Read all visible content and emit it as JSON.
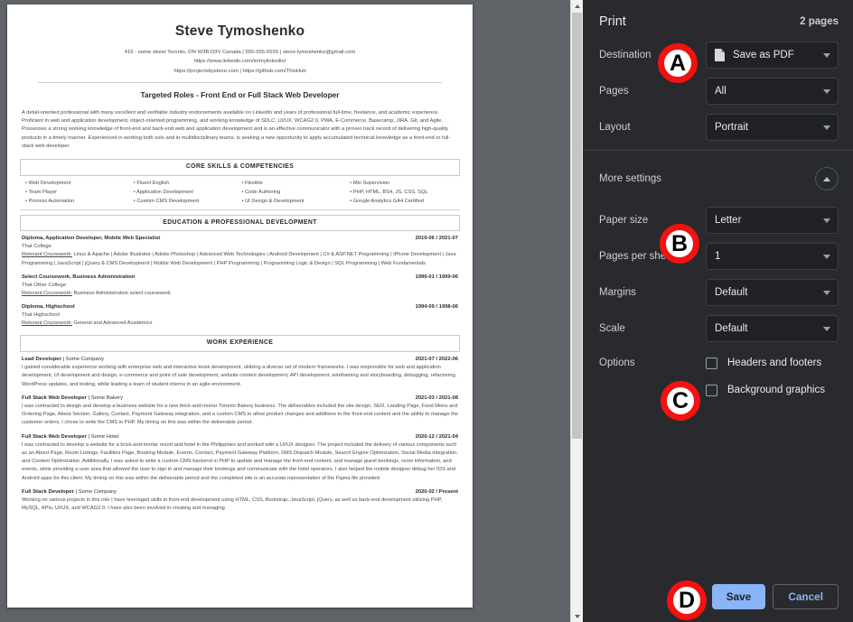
{
  "print_panel": {
    "title": "Print",
    "pages_count": "2 pages",
    "destination": {
      "label": "Destination",
      "value": "Save as PDF",
      "icon": "file-icon"
    },
    "pages": {
      "label": "Pages",
      "value": "All"
    },
    "layout": {
      "label": "Layout",
      "value": "Portrait"
    },
    "more_settings": {
      "label": "More settings",
      "icon": "chevron-up-icon"
    },
    "paper_size": {
      "label": "Paper size",
      "value": "Letter"
    },
    "pages_per_sheet": {
      "label": "Pages per sheet",
      "value": "1"
    },
    "margins": {
      "label": "Margins",
      "value": "Default"
    },
    "scale": {
      "label": "Scale",
      "value": "Default"
    },
    "options": {
      "label": "Options",
      "headers_and_footers": {
        "label": "Headers and footers",
        "checked": false
      },
      "background_graphics": {
        "label": "Background graphics",
        "checked": false
      }
    },
    "save_button": "Save",
    "cancel_button": "Cancel",
    "accent_color": "#8ab4f8",
    "panel_background": "#292a2d"
  },
  "annotations": {
    "color": "#f31111",
    "a": "A",
    "b": "B",
    "c": "C",
    "d": "D"
  },
  "document": {
    "name": "Steve Tymoshenko",
    "contact_line1": "416 - some street Toronto, ON W3B D3V Canada | 555-555-5555 | steve.tymoshenko@gmail.com",
    "contact_line2": "https://www.linkedin.com/in/mylinkedin/",
    "contact_line3": "https://projectsbysteve.com | https://github.com/ThisHub",
    "targeted_roles": "Targeted Roles - Front End or Full Stack Web Developer",
    "summary": "A detail-oriented professional with many excellent and verifiable industry endorsements available on LinkedIn and years of professional full-time, freelance, and academic experience. Proficient in web and application development, object-oriented programming, and working knowledge of SDLC, UI/UX, WCAG2.0, PWA, E-Commerce, Basecamp, JIRA, Git, and Agile. Possesses a strong working knowledge of front-end and back-end web and application development and is an effective communicator with a proven track record of delivering high-quality products in a timely manner. Experienced in working both solo and in multidisciplinary teams, is seeking a new opportunity to apply accumulated technical knowledge as a front-end or full-stack web developer.",
    "core_skills_heading": "CORE SKILLS & COMPETENCIES",
    "skills": [
      "• Web Development",
      "• Fluent English",
      "• Flexible",
      "• Min Supervision",
      "• Team Player",
      "• Application Development",
      "• Code Authoring",
      "• PHP, HTML, BS4, JS, CSS, SQL",
      "• Process Automation",
      "• Custom CMS Development",
      "• UI Design & Development",
      "• Google Analytics GA4 Certified"
    ],
    "education_heading": "EDUCATION & PROFESSIONAL DEVELOPMENT",
    "education": [
      {
        "title": "Diploma, Application Developer, Mobile Web Specialist",
        "date": "2019-06 / 2021-07",
        "org": "That College",
        "coursework_label": "Relevant Coursework:",
        "coursework": " Linux & Apache | Adobe Illustrator | Adobe Photoshop | Advanced Web Technologies | Android Development | C# & ASP.NET Programming | iPhone Development | Java Programming | JavaScript | jQuery & CMS Development | Mobile Web Development | PHP Programming | Programming Logic & Design | SQL Programming | Web Fundamentals"
      },
      {
        "title": "Select Coursework, Business Administration",
        "date": "1999-01 / 1999-06",
        "org": "That Other College",
        "coursework_label": "Relevant Coursework:",
        "coursework": " Business Administration select coursework"
      },
      {
        "title": "Diploma, Highschool",
        "date": "1994-09 / 1998-06",
        "org": "That Highschool",
        "coursework_label": "Relevant Coursework:",
        "coursework": " General and Advanced Academics"
      }
    ],
    "work_heading": "WORK EXPERIENCE",
    "work": [
      {
        "role": "Lead Developer",
        "company": " | Some Company",
        "date": "2021-07 / 2022-06",
        "desc": "I gained considerable experience working with enterprise web and interactive kiosk development, utilizing a diverse set of modern frameworks. I was responsible for web and application development, UI development and design, e-commerce and point of sale development, website content development, API development, wireframing and storyboarding, debugging, refactoring, WordPress updates, and testing, while leading a team of student interns in an agile environment."
      },
      {
        "role": "Full Stack Web Developer",
        "company": " | Some Bakery",
        "date": "2021-03 / 2021-08",
        "desc": "I was contracted to design and develop a business website for a new brick-and-mortar Toronto Bakery business. The deliverables included the site design, SEO, Landing Page, Food Menu and Ordering Page, About Section, Gallery, Contact, Payment Gateway integration, and a custom CMS to allow product changes and additions to the front-end content and the ability to manage the customer orders, I chose to write the CMS in PHP. My timing on this was within the deliverable period."
      },
      {
        "role": "Full Stack Web Developer",
        "company": " | Some Hotel",
        "date": "2020-12 / 2021-04",
        "desc": "I was contracted to develop a website for a brick-and-mortar resort and hotel in the Philippines and worked with a UI/UX designer. The project included the delivery of various components such as an About Page, Room Listings, Facilities Page, Booking Module, Events, Contact, Payment Gateway Platform, SMS Dispatch Module, Search Engine Optimization, Social Media Integration, and Content Optimization. Additionally, I was asked to write a custom CMS backend in PHP to update and manage the front-end content, and manage guest bookings, room information, and events, while providing a user area that allowed the user to sign in and manage their bookings and communicate with the hotel operators. I also helped the mobile designer debug her IOS and Android apps for this client. My timing on this was within the deliverable period and the completed site is an accurate representation of the Figma file provided."
      },
      {
        "role": "Full Stack Developer",
        "company": " | Some Company",
        "date": "2020-02 / Present",
        "desc": "Working on various projects in this role I have leveraged skills in front-end development using HTML, CSS, Bootstrap, JavaScript, jQuery, as well as back-end development utilizing PHP, MySQL, APIs, UI/UX, and WCAG2.0. I have also been involved in creating and managing"
      }
    ]
  }
}
